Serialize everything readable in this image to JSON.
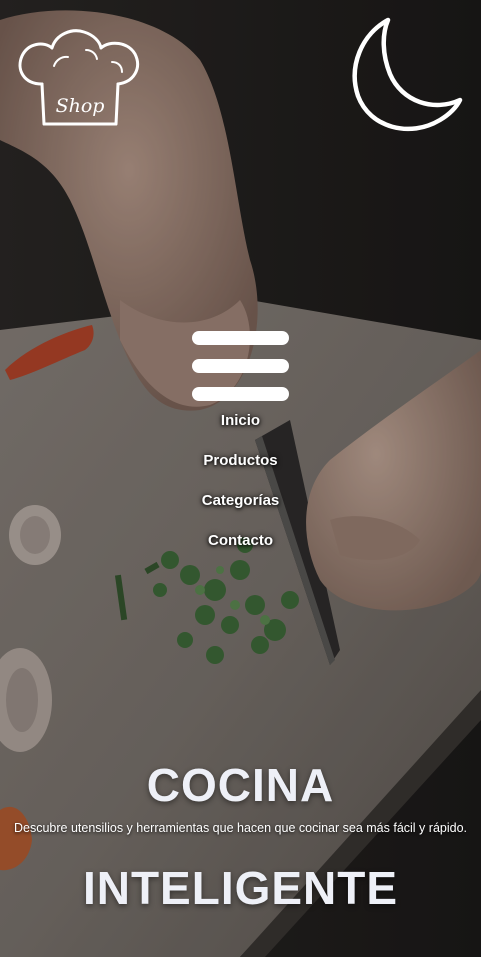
{
  "logo": {
    "text": "Shop",
    "icon": "chef-hat-icon"
  },
  "theme_toggle": {
    "icon": "moon-icon"
  },
  "menu": {
    "icon": "hamburger-menu-icon",
    "items": [
      {
        "label": "Inicio"
      },
      {
        "label": "Productos"
      },
      {
        "label": "Categorías"
      },
      {
        "label": "Contacto"
      }
    ]
  },
  "hero": {
    "title_top": "COCINA",
    "subtitle": "Descubre utensilios y herramientas que hacen que cocinar sea más fácil y rápido.",
    "title_bottom": "INTELIGENTE"
  },
  "colors": {
    "text_primary": "#ffffff",
    "title_color": "#eef0f7",
    "background_dark": "#1e1b19"
  }
}
